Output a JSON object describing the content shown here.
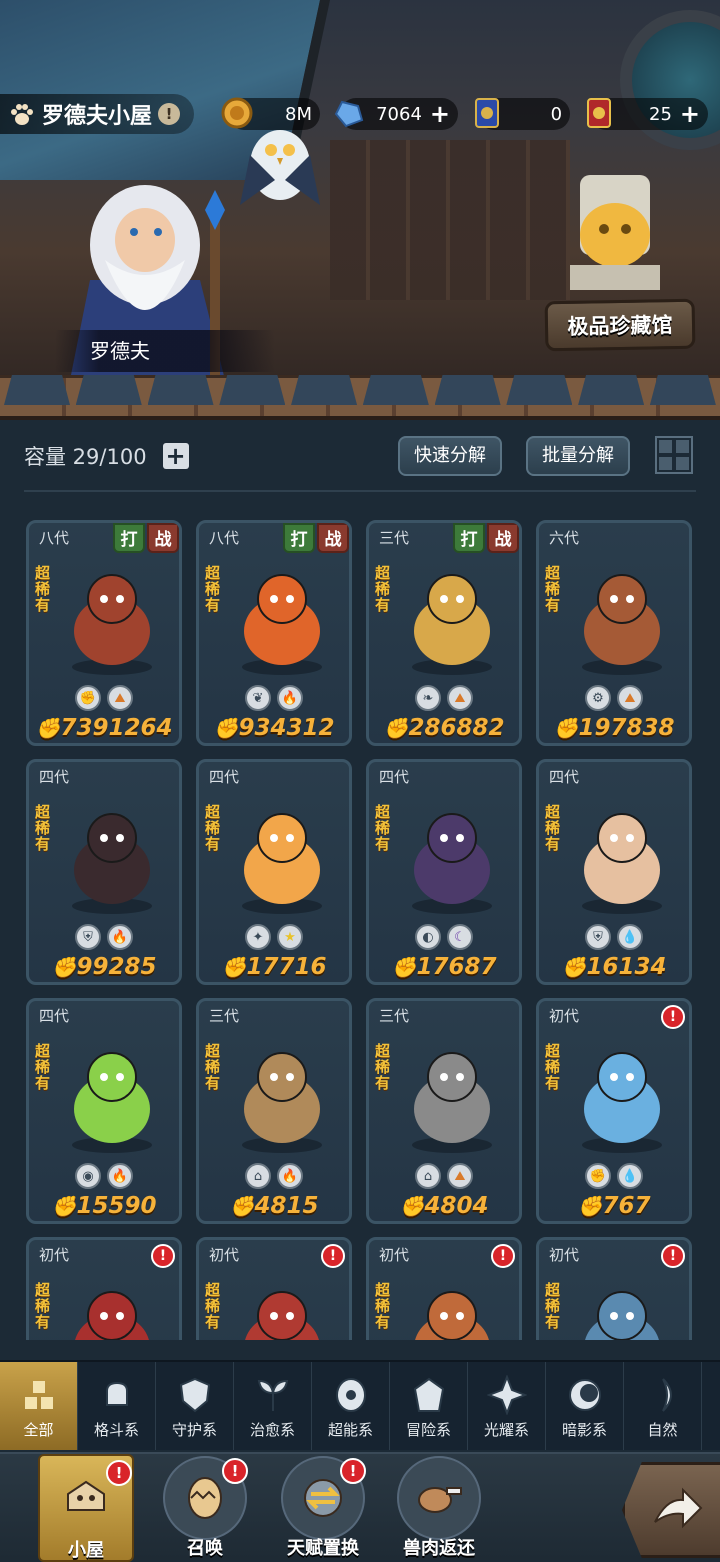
{
  "header": {
    "house_name": "罗德夫小屋",
    "wizard_name": "罗德夫",
    "collection_button": "极品珍藏馆",
    "resources": [
      {
        "icon": "gold-coin-icon",
        "value": "8M",
        "has_plus": false
      },
      {
        "icon": "crystal-icon",
        "value": "7064",
        "has_plus": true
      },
      {
        "icon": "generation-card-icon",
        "value": "0",
        "has_plus": false
      },
      {
        "icon": "gold-card-icon",
        "value": "25",
        "has_plus": true
      }
    ]
  },
  "toolbar": {
    "capacity": "容量 29/100",
    "quick_decompose": "快速分解",
    "batch_decompose": "批量分解"
  },
  "rarity_label": "超稀有",
  "tag_labels": {
    "hit": "打",
    "war": "战"
  },
  "pets": [
    {
      "gen": "八代",
      "tags": true,
      "alert": false,
      "power": "7391264",
      "types": [
        "fist",
        "earth"
      ],
      "color": "#a0432e"
    },
    {
      "gen": "八代",
      "tags": true,
      "alert": false,
      "power": "934312",
      "types": [
        "leaf",
        "fire"
      ],
      "color": "#e0652a"
    },
    {
      "gen": "三代",
      "tags": true,
      "alert": false,
      "power": "286882",
      "types": [
        "leaf-water",
        "earth"
      ],
      "color": "#d8a84a"
    },
    {
      "gen": "六代",
      "tags": false,
      "alert": false,
      "power": "197838",
      "types": [
        "gear",
        "earth"
      ],
      "color": "#a55a36"
    },
    {
      "gen": "四代",
      "tags": false,
      "alert": false,
      "power": "99285",
      "types": [
        "shield",
        "fire"
      ],
      "color": "#3a2a2e"
    },
    {
      "gen": "四代",
      "tags": false,
      "alert": false,
      "power": "17716",
      "types": [
        "light",
        "star"
      ],
      "color": "#f2a64a"
    },
    {
      "gen": "四代",
      "tags": false,
      "alert": false,
      "power": "17687",
      "types": [
        "shadow",
        "moon"
      ],
      "color": "#4c3a6a"
    },
    {
      "gen": "四代",
      "tags": false,
      "alert": false,
      "power": "16134",
      "types": [
        "shield",
        "water"
      ],
      "color": "#e6c0a0"
    },
    {
      "gen": "四代",
      "tags": false,
      "alert": false,
      "power": "15590",
      "types": [
        "psychic",
        "fire"
      ],
      "color": "#8ad04a"
    },
    {
      "gen": "三代",
      "tags": false,
      "alert": false,
      "power": "4815",
      "types": [
        "adventure",
        "fire"
      ],
      "color": "#b08a5a"
    },
    {
      "gen": "三代",
      "tags": false,
      "alert": false,
      "power": "4804",
      "types": [
        "adventure",
        "earth"
      ],
      "color": "#8a8a8a"
    },
    {
      "gen": "初代",
      "tags": false,
      "alert": true,
      "power": "767",
      "types": [
        "fist",
        "water"
      ],
      "color": "#6ab0e0"
    },
    {
      "gen": "初代",
      "tags": false,
      "alert": true,
      "power": "",
      "types": [],
      "color": "#a8302e"
    },
    {
      "gen": "初代",
      "tags": false,
      "alert": true,
      "power": "",
      "types": [],
      "color": "#b03a32"
    },
    {
      "gen": "初代",
      "tags": false,
      "alert": true,
      "power": "",
      "types": [],
      "color": "#c06a3a"
    },
    {
      "gen": "初代",
      "tags": false,
      "alert": true,
      "power": "",
      "types": [],
      "color": "#5a8ab0"
    }
  ],
  "categories": [
    {
      "label": "全部",
      "icon": "all-blocks-icon",
      "active": true
    },
    {
      "label": "格斗系",
      "icon": "fist-icon",
      "active": false
    },
    {
      "label": "守护系",
      "icon": "shield-icon",
      "active": false
    },
    {
      "label": "治愈系",
      "icon": "sprout-icon",
      "active": false
    },
    {
      "label": "超能系",
      "icon": "psychic-icon",
      "active": false
    },
    {
      "label": "冒险系",
      "icon": "adventure-icon",
      "active": false
    },
    {
      "label": "光耀系",
      "icon": "radiant-icon",
      "active": false
    },
    {
      "label": "暗影系",
      "icon": "shadow-icon",
      "active": false
    },
    {
      "label": "自然",
      "icon": "nature-icon",
      "active": false
    }
  ],
  "nav": [
    {
      "label": "小屋",
      "icon": "house-icon",
      "alert": true,
      "active": true
    },
    {
      "label": "召唤",
      "icon": "egg-icon",
      "alert": true,
      "active": false
    },
    {
      "label": "天赋置换",
      "icon": "swap-icon",
      "alert": true,
      "active": false
    },
    {
      "label": "兽肉返还",
      "icon": "meat-icon",
      "alert": false,
      "active": false
    }
  ],
  "alert_glyph": "!",
  "plus_glyph": "+"
}
